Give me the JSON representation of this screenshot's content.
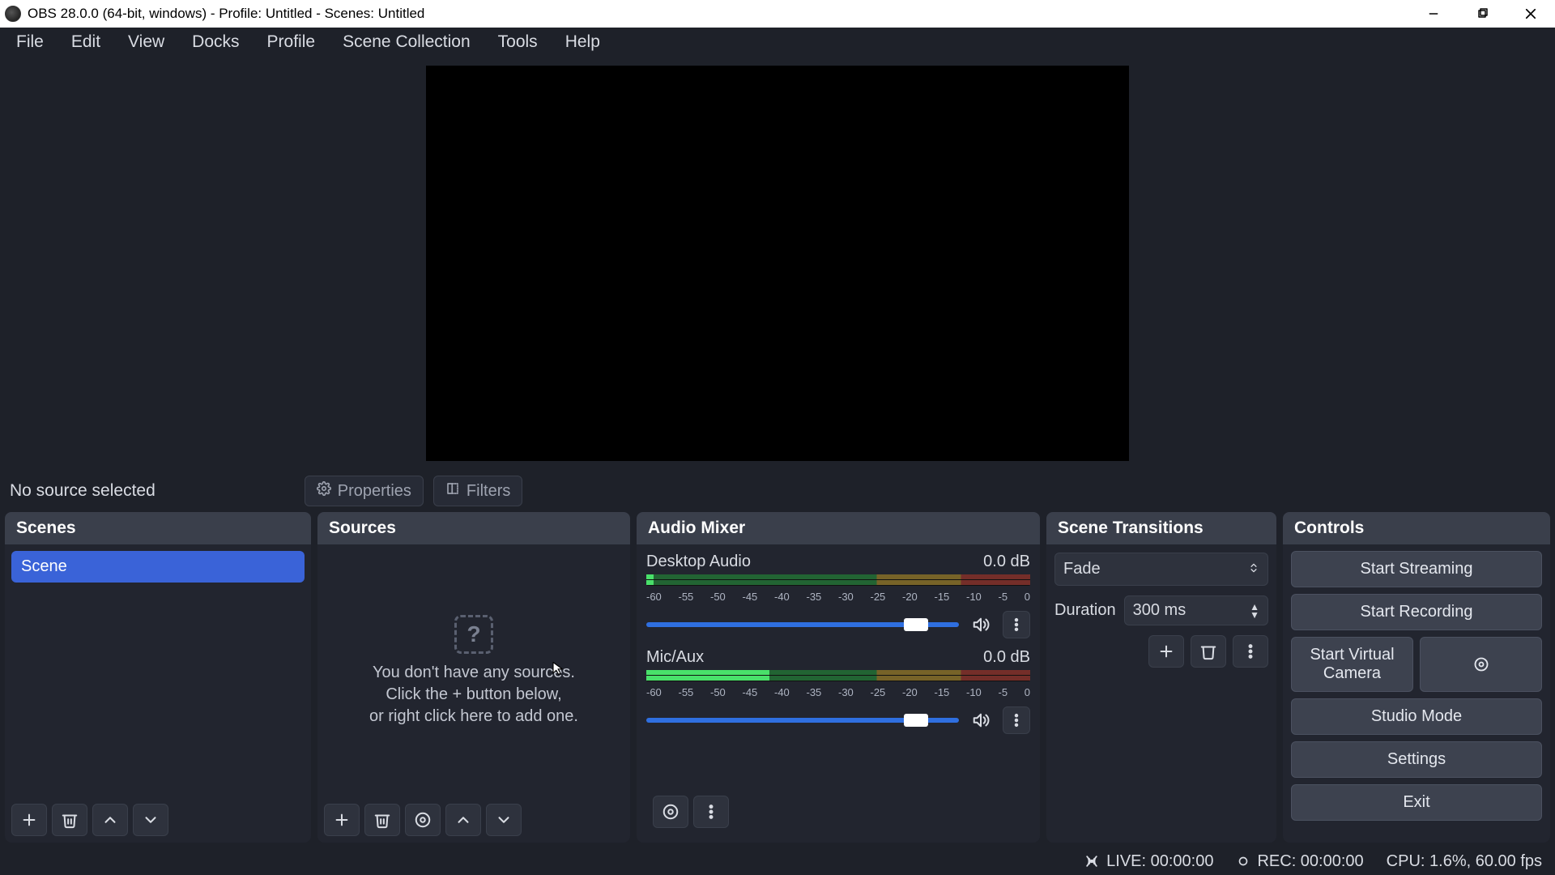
{
  "window": {
    "title": "OBS 28.0.0 (64-bit, windows) - Profile: Untitled - Scenes: Untitled"
  },
  "menus": [
    "File",
    "Edit",
    "View",
    "Docks",
    "Profile",
    "Scene Collection",
    "Tools",
    "Help"
  ],
  "source_toolbar": {
    "status": "No source selected",
    "properties_label": "Properties",
    "filters_label": "Filters"
  },
  "scenes": {
    "title": "Scenes",
    "items": [
      "Scene"
    ]
  },
  "sources": {
    "title": "Sources",
    "empty_line1": "You don't have any sources.",
    "empty_line2": "Click the + button below,",
    "empty_line3": "or right click here to add one."
  },
  "mixer": {
    "title": "Audio Mixer",
    "ticks": [
      "-60",
      "-55",
      "-50",
      "-45",
      "-40",
      "-35",
      "-30",
      "-25",
      "-20",
      "-15",
      "-10",
      "-5",
      "0"
    ],
    "channels": [
      {
        "name": "Desktop Audio",
        "db": "0.0 dB"
      },
      {
        "name": "Mic/Aux",
        "db": "0.0 dB"
      }
    ]
  },
  "transitions": {
    "title": "Scene Transitions",
    "selected": "Fade",
    "duration_label": "Duration",
    "duration_value": "300 ms"
  },
  "controls": {
    "title": "Controls",
    "start_streaming": "Start Streaming",
    "start_recording": "Start Recording",
    "virtual_camera": "Start Virtual Camera",
    "studio_mode": "Studio Mode",
    "settings": "Settings",
    "exit": "Exit"
  },
  "status": {
    "live": "LIVE: 00:00:00",
    "rec": "REC: 00:00:00",
    "cpu": "CPU: 1.6%, 60.00 fps"
  }
}
